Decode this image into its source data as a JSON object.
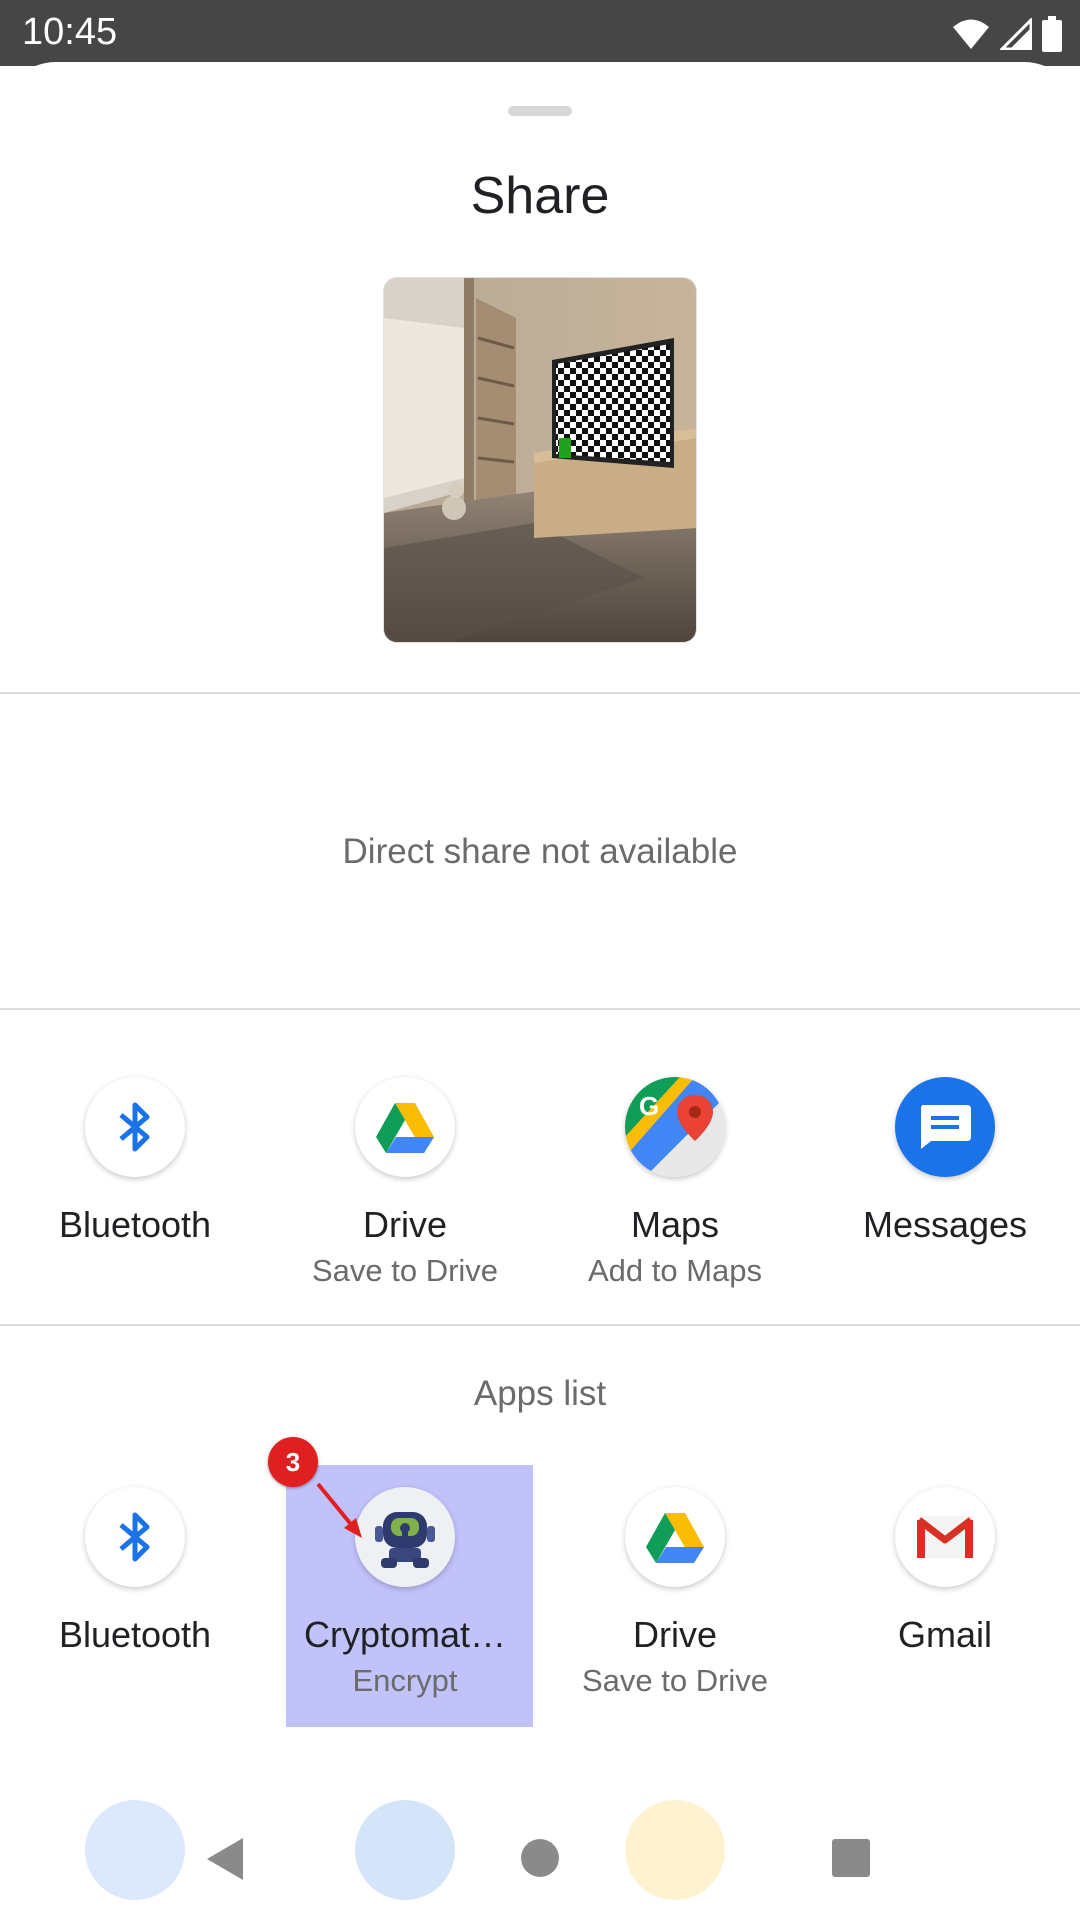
{
  "status_bar": {
    "time": "10:45",
    "icons": [
      "wifi-icon",
      "signal-icon",
      "battery-icon"
    ]
  },
  "share_sheet": {
    "title": "Share",
    "preview": "image-thumbnail",
    "direct_share_text": "Direct share not available",
    "top_targets": [
      {
        "name": "bluetooth",
        "label": "Bluetooth",
        "sub": ""
      },
      {
        "name": "drive",
        "label": "Drive",
        "sub": "Save to Drive"
      },
      {
        "name": "maps",
        "label": "Maps",
        "sub": "Add to Maps"
      },
      {
        "name": "messages",
        "label": "Messages",
        "sub": ""
      }
    ],
    "apps_list_label": "Apps list",
    "apps": [
      {
        "name": "bluetooth",
        "label": "Bluetooth",
        "sub": ""
      },
      {
        "name": "cryptomator",
        "label": "Cryptomat…",
        "sub": "Encrypt"
      },
      {
        "name": "drive",
        "label": "Drive",
        "sub": "Save to Drive"
      },
      {
        "name": "gmail",
        "label": "Gmail",
        "sub": ""
      }
    ]
  },
  "annotation": {
    "step_number": "3",
    "color": "#e02020"
  },
  "colors": {
    "highlight": "#8e8ef5",
    "status_bar": "#464646",
    "bluetooth": "#1a73e8"
  }
}
